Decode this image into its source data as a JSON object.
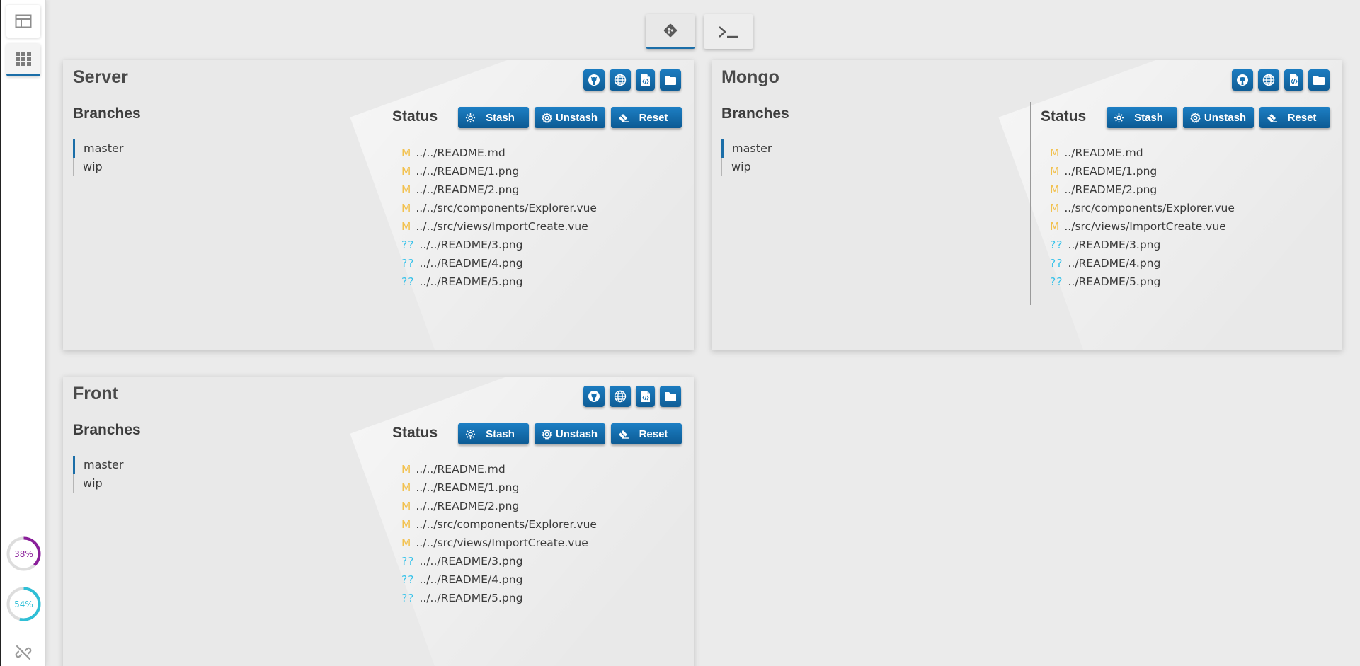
{
  "sidebar": {
    "items": [
      {
        "icon": "layout-icon"
      },
      {
        "icon": "grid-icon",
        "active": true
      }
    ],
    "gauges": [
      {
        "label": "38%",
        "value": 0.38,
        "color": "#8a1e9a"
      },
      {
        "label": "54%",
        "value": 0.54,
        "color": "#2fbfd6"
      }
    ],
    "bottom_icon": "unlink-icon"
  },
  "top_tabs": [
    {
      "icon": "git-icon",
      "active": true
    },
    {
      "icon": "terminal-icon",
      "active": false
    }
  ],
  "actions": {
    "stash": "Stash",
    "unstash": "Unstash",
    "reset": "Reset"
  },
  "labels": {
    "branches": "Branches",
    "status": "Status"
  },
  "panels": [
    {
      "title": "Server",
      "branches": [
        "master",
        "wip"
      ],
      "active_branch": "master",
      "files": [
        {
          "code": "M",
          "path": "../../README.md"
        },
        {
          "code": "M",
          "path": "../../README/1.png"
        },
        {
          "code": "M",
          "path": "../../README/2.png"
        },
        {
          "code": "M",
          "path": "../../src/components/Explorer.vue"
        },
        {
          "code": "M",
          "path": "../../src/views/ImportCreate.vue"
        },
        {
          "code": "??",
          "path": "../../README/3.png"
        },
        {
          "code": "??",
          "path": "../../README/4.png"
        },
        {
          "code": "??",
          "path": "../../README/5.png"
        }
      ]
    },
    {
      "title": "Mongo",
      "branches": [
        "master",
        "wip"
      ],
      "active_branch": "master",
      "files": [
        {
          "code": "M",
          "path": "../README.md"
        },
        {
          "code": "M",
          "path": "../README/1.png"
        },
        {
          "code": "M",
          "path": "../README/2.png"
        },
        {
          "code": "M",
          "path": "../src/components/Explorer.vue"
        },
        {
          "code": "M",
          "path": "../src/views/ImportCreate.vue"
        },
        {
          "code": "??",
          "path": "../README/3.png"
        },
        {
          "code": "??",
          "path": "../README/4.png"
        },
        {
          "code": "??",
          "path": "../README/5.png"
        }
      ]
    },
    {
      "title": "Front",
      "branches": [
        "master",
        "wip"
      ],
      "active_branch": "master",
      "files": [
        {
          "code": "M",
          "path": "../../README.md"
        },
        {
          "code": "M",
          "path": "../../README/1.png"
        },
        {
          "code": "M",
          "path": "../../README/2.png"
        },
        {
          "code": "M",
          "path": "../../src/components/Explorer.vue"
        },
        {
          "code": "M",
          "path": "../../src/views/ImportCreate.vue"
        },
        {
          "code": "??",
          "path": "../../README/3.png"
        },
        {
          "code": "??",
          "path": "../../README/4.png"
        },
        {
          "code": "??",
          "path": "../../README/5.png"
        }
      ]
    }
  ],
  "panel_icons": [
    "github-icon",
    "globe-icon",
    "code-file-icon",
    "folder-icon"
  ],
  "colors": {
    "accent": "#1b6ea8",
    "modified": "#f2c14e",
    "untracked": "#36c2ea"
  }
}
